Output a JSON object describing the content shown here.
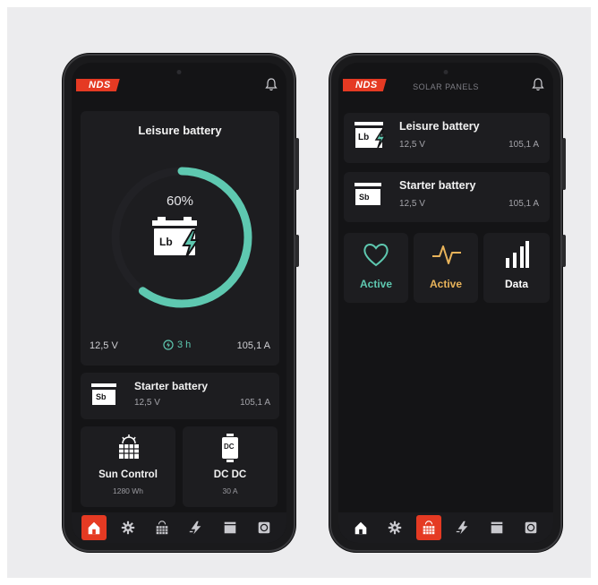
{
  "left": {
    "brand": "NDS",
    "main_card": {
      "title": "Leisure battery",
      "percent": "60%",
      "charge_level": 0.6,
      "icon_letters": "Lb",
      "voltage": "12,5 V",
      "time": "3 h",
      "current": "105,1 A"
    },
    "starter": {
      "title": "Starter battery",
      "icon_letters": "Sb",
      "voltage": "12,5 V",
      "current": "105,1 A"
    },
    "tiles": [
      {
        "label": "Sun Control",
        "value": "1280 Wh",
        "icon": "solar-panel-icon"
      },
      {
        "label": "DC DC",
        "value": "30 A",
        "icon": "dc-converter-icon",
        "icon_letters": "DC"
      }
    ],
    "nav": [
      "home-icon",
      "gear-icon",
      "solar-panel-icon",
      "lightning-icon",
      "battery-icon",
      "power-icon"
    ],
    "active_nav": 0
  },
  "right": {
    "brand": "NDS",
    "header_title": "SOLAR PANELS",
    "batteries": [
      {
        "title": "Leisure battery",
        "icon_letters": "Lb",
        "voltage": "12,5 V",
        "current": "105,1 A"
      },
      {
        "title": "Starter battery",
        "icon_letters": "Sb",
        "voltage": "12,5 V",
        "current": "105,1 A"
      }
    ],
    "actions": [
      {
        "label": "Active",
        "icon": "heart-icon",
        "color": "#5ec8b0"
      },
      {
        "label": "Active",
        "icon": "pulse-icon",
        "color": "#e8b35a"
      },
      {
        "label": "Data",
        "icon": "bar-chart-icon",
        "color": "#ffffff"
      }
    ],
    "nav": [
      "home-icon",
      "gear-icon",
      "solar-panel-icon",
      "lightning-icon",
      "battery-icon",
      "power-icon"
    ],
    "active_nav": 2
  },
  "colors": {
    "accent": "#e53a23",
    "teal": "#5ec8b0",
    "amber": "#e8b35a",
    "card": "#1d1d20",
    "screen": "#141416"
  }
}
